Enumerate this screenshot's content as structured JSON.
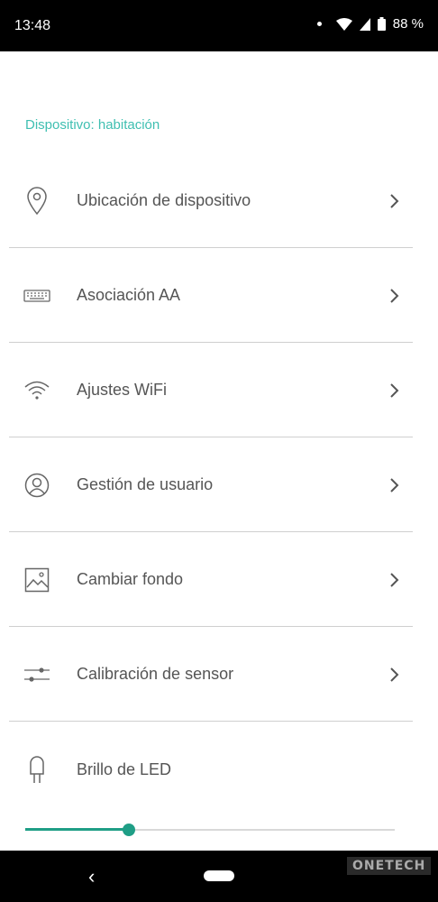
{
  "status_bar": {
    "time": "13:48",
    "battery": "88 %"
  },
  "section_title": "Dispositivo: habitación",
  "menu": [
    {
      "label": "Ubicación de dispositivo",
      "icon": "location-pin-icon"
    },
    {
      "label": "Asociación AA",
      "icon": "keyboard-icon"
    },
    {
      "label": "Ajustes WiFi",
      "icon": "wifi-icon"
    },
    {
      "label": "Gestión de usuario",
      "icon": "user-icon"
    },
    {
      "label": "Cambiar fondo",
      "icon": "image-icon"
    },
    {
      "label": "Calibración de sensor",
      "icon": "sliders-icon"
    }
  ],
  "led": {
    "label": "Brillo de LED",
    "icon": "led-bulb-icon",
    "brightness": 0.28
  },
  "watermark": "ONETECH",
  "colors": {
    "accent": "#3fbfb1",
    "slider": "#1f9e86",
    "text": "#555555"
  }
}
